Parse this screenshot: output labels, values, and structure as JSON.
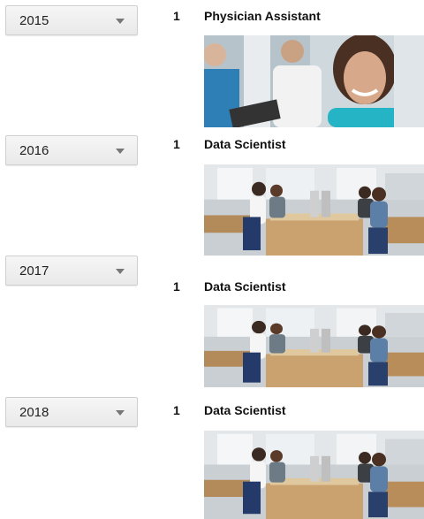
{
  "rows": [
    {
      "year": "2015",
      "rank": "1",
      "title": "Physician Assistant",
      "image": "healthcare-team-photo"
    },
    {
      "year": "2016",
      "rank": "1",
      "title": "Data Scientist",
      "image": "office-workers-photo"
    },
    {
      "year": "2017",
      "rank": "1",
      "title": "Data Scientist",
      "image": "office-workers-photo"
    },
    {
      "year": "2018",
      "rank": "1",
      "title": "Data Scientist",
      "image": "office-workers-photo"
    }
  ]
}
